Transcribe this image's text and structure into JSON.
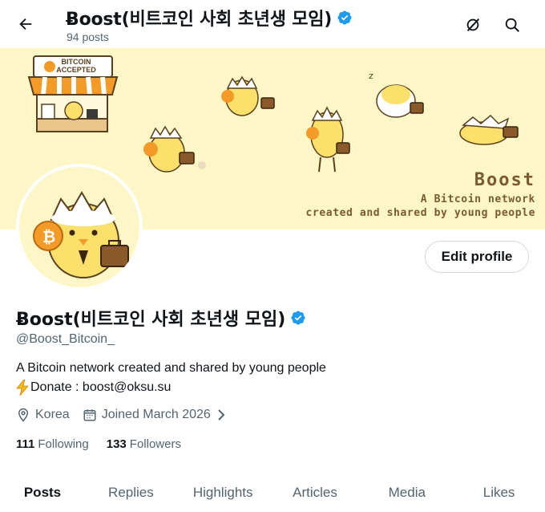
{
  "header": {
    "title": "Ƀoost(비트코인 사회 초년생 모임)",
    "posts_count": "94 posts",
    "back_icon": "back-arrow-icon",
    "grok_icon": "grok-icon",
    "search_icon": "search-icon"
  },
  "banner": {
    "sign_line1": "BITCOIN",
    "sign_line2": "ACCEPTED",
    "title": "Boost",
    "subtitle_line1": "A Bitcoin network",
    "subtitle_line2": "created and shared  by young people"
  },
  "profile": {
    "edit_button": "Edit profile",
    "display_name": "Ƀoost(비트코인 사회 초년생 모임)",
    "handle": "@Boost_Bitcoin_",
    "bio_line1": "A Bitcoin network created and shared by young people",
    "bio_line2": "Donate : boost@oksu.su",
    "location": "Korea",
    "joined": "Joined March 2026",
    "following_count": "111",
    "following_label": "Following",
    "followers_count": "133",
    "followers_label": "Followers"
  },
  "tabs": [
    {
      "label": "Posts",
      "active": true
    },
    {
      "label": "Replies"
    },
    {
      "label": "Highlights"
    },
    {
      "label": "Articles"
    },
    {
      "label": "Media"
    },
    {
      "label": "Likes"
    }
  ],
  "colors": {
    "accent_verified": "#1d9bf0",
    "banner_bg": "#fdf6c6",
    "banner_text": "#7a5a2e",
    "bitcoin_orange": "#f39a27"
  }
}
